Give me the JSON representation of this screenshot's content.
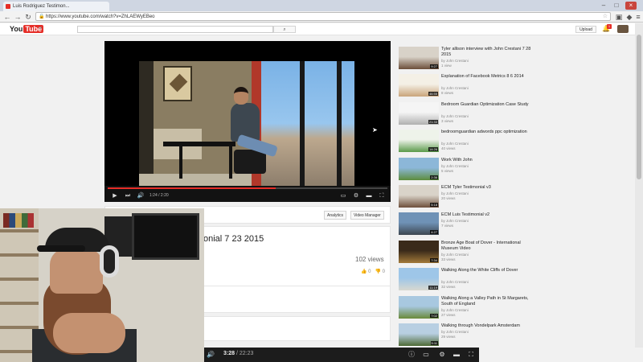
{
  "browser": {
    "tab_title": "Luis Rodriguez Testimon...",
    "url": "https://www.youtube.com/watch?v=ZhLAEWyEBeo",
    "lock_icon": "lock-icon",
    "star_icon": "star-icon"
  },
  "youtube": {
    "logo_you": "You",
    "logo_tube": "Tube",
    "upload_label": "Upload",
    "notification_count": "1"
  },
  "player": {
    "time_text": "1:24 / 2:20",
    "progress_fraction": 0.6
  },
  "video": {
    "title_visible": "onial 7 23 2015",
    "views": "102 views",
    "like_count": "0",
    "dislike_count": "0",
    "analytics_label": "Analytics",
    "video_manager_label": "Video Manager"
  },
  "sidebar": {
    "items": [
      {
        "title": "Tyler allison interview with John Crestani 7 28 2015",
        "author": "by John Crestani",
        "views": "1 view",
        "duration": "9:27",
        "thumb": [
          "#d8d2c8",
          "#6b4e3a"
        ]
      },
      {
        "title": "Explanation of Facebook Metrics 8 6 2014",
        "author": "by John Crestani",
        "views": "8 views",
        "duration": "46:55",
        "thumb": [
          "#f4f0e6",
          "#c9a57a"
        ]
      },
      {
        "title": "Bedroom Guardian Optimization Case Study",
        "author": "by John Crestani",
        "views": "3 views",
        "duration": "21:33",
        "thumb": [
          "#f5f5f5",
          "#b0b0b0"
        ]
      },
      {
        "title": "bedroomguardian adwords ppc optimization",
        "author": "by John Crestani",
        "views": "40 views",
        "duration": "14:26",
        "thumb": [
          "#eef3ea",
          "#5a9a4a"
        ]
      },
      {
        "title": "Work With John",
        "author": "by John Crestani",
        "views": "5 views",
        "duration": "2:36",
        "thumb": [
          "#8cb7d8",
          "#5c8c3c"
        ]
      },
      {
        "title": "ECM Tyler Testimonial v3",
        "author": "by John Crestani",
        "views": "20 views",
        "duration": "5:18",
        "thumb": [
          "#d9d3c9",
          "#6e4f3b"
        ]
      },
      {
        "title": "ECM Luis Testimonial v2",
        "author": "by John Crestani",
        "views": "7 views",
        "duration": "4:27",
        "thumb": [
          "#6f92b6",
          "#3d4750"
        ]
      },
      {
        "title": "Bronze Age Boat of Dover - International Museum Video",
        "author": "by John Crestani",
        "views": "33 views",
        "duration": "7:34",
        "thumb": [
          "#3a2a1a",
          "#a37a3a"
        ]
      },
      {
        "title": "Walking Along the White Cliffs of Dover",
        "author": "by John Crestani",
        "views": "32 views",
        "duration": "11:19",
        "thumb": [
          "#9ec6e8",
          "#d8d8d0"
        ]
      },
      {
        "title": "Walking Along a Valley Path in St Margarets, South of England",
        "author": "by John Crestani",
        "views": "27 views",
        "duration": "7:02",
        "thumb": [
          "#a8c8e0",
          "#6a8a3a"
        ]
      },
      {
        "title": "Walking through Vondelpark Amsterdam",
        "author": "by John Crestani",
        "views": "29 views",
        "duration": "5:11",
        "thumb": [
          "#b8cfe2",
          "#4e6a34"
        ]
      }
    ]
  },
  "bottom_player": {
    "current_time": "3:28",
    "duration": "/ 22:23"
  },
  "colors": {
    "youtube_red": "#e52d27",
    "page_bg": "#f1f1f1"
  }
}
